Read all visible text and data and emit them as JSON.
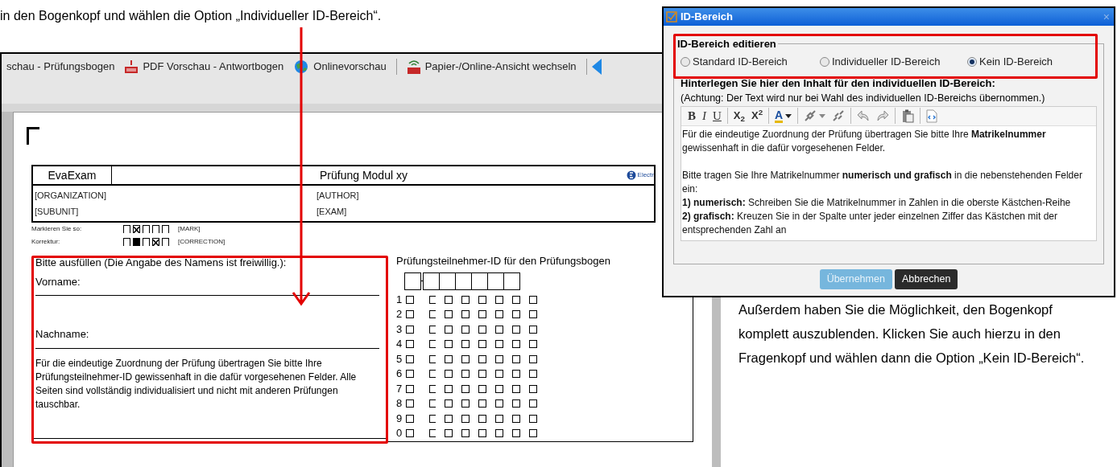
{
  "intro": "in den Bogenkopf und wählen die Option „Individueller ID-Bereich“.",
  "toolbar": {
    "items": [
      {
        "label": "schau - Prüfungsbogen",
        "kind": "plain"
      },
      {
        "label": "PDF Vorschau - Antwortbogen",
        "kind": "pdf"
      },
      {
        "label": "Onlinevorschau",
        "kind": "globe"
      },
      {
        "label": "Papier-/Online-Ansicht wechseln",
        "kind": "switch"
      }
    ]
  },
  "sheet": {
    "header": {
      "brand": "EvaExam",
      "title": "Prüfung Modul xy",
      "logo": "Electr",
      "fields": [
        [
          "[ORGANIZATION]",
          "[AUTHOR]"
        ],
        [
          "[SUBUNIT]",
          "[EXAM]"
        ]
      ]
    },
    "marking": [
      {
        "label": "Markieren Sie so:",
        "boxes": [
          {
            "kind": "box",
            "checked": false
          },
          {
            "kind": "box",
            "checked": true
          },
          {
            "kind": "box",
            "checked": false
          },
          {
            "kind": "box",
            "checked": false
          },
          {
            "kind": "box",
            "checked": false
          }
        ],
        "tag": "[MARK]"
      },
      {
        "label": "Korrektur:",
        "boxes": [
          {
            "kind": "box",
            "checked": false
          },
          {
            "kind": "blacked",
            "checked": false
          },
          {
            "kind": "box",
            "checked": false
          },
          {
            "kind": "box",
            "checked": true
          },
          {
            "kind": "box",
            "checked": false
          }
        ],
        "tag": "[CORRECTION]"
      }
    ],
    "name_form": {
      "heading": "Bitte ausfüllen (Die Angabe des Namens ist freiwillig.):",
      "fields": [
        "Vorname:",
        "Nachname:"
      ],
      "notice": "Für die eindeutige Zuordnung der Prüfung übertragen Sie bitte Ihre Prüfungsteilnehmer-ID gewissenhaft in die dafür vorgesehenen Felder. Alle Seiten sind vollständig individualisiert und nicht mit anderen Prüfungen tauschbar."
    },
    "id_grid": {
      "heading": "Prüfungsteilnehmer-ID für den Prüfungsbogen",
      "rows": [
        {
          "digit": "1",
          "checked": [
            false,
            false,
            false,
            false,
            false,
            false,
            false
          ]
        },
        {
          "digit": "2",
          "checked": [
            false,
            false,
            false,
            false,
            false,
            false,
            false
          ]
        },
        {
          "digit": "3",
          "checked": [
            false,
            false,
            false,
            false,
            false,
            false,
            false
          ]
        },
        {
          "digit": "4",
          "checked": [
            false,
            false,
            false,
            false,
            false,
            false,
            false
          ]
        },
        {
          "digit": "5",
          "checked": [
            false,
            false,
            false,
            false,
            false,
            false,
            false
          ]
        },
        {
          "digit": "6",
          "checked": [
            false,
            false,
            false,
            false,
            false,
            false,
            false
          ]
        },
        {
          "digit": "7",
          "checked": [
            false,
            false,
            false,
            false,
            false,
            false,
            false
          ]
        },
        {
          "digit": "8",
          "checked": [
            false,
            false,
            false,
            false,
            false,
            false,
            false
          ]
        },
        {
          "digit": "9",
          "checked": [
            false,
            false,
            false,
            false,
            false,
            false,
            false
          ]
        },
        {
          "digit": "0",
          "checked": [
            false,
            false,
            false,
            false,
            false,
            false,
            false
          ]
        }
      ]
    }
  },
  "dialog": {
    "title": "ID-Bereich",
    "close": "×",
    "legend": "ID-Bereich editieren",
    "options": [
      {
        "label": "Standard ID-Bereich",
        "selected": false
      },
      {
        "label": "Individueller ID-Bereich",
        "selected": false
      },
      {
        "label": "Kein ID-Bereich",
        "selected": true
      }
    ],
    "heading": "Hinterlegen Sie hier den Inhalt für den individuellen ID-Bereich:",
    "note": "(Achtung: Der Text wird nur bei Wahl des individuellen ID-Bereichs übernommen.)",
    "tools": [
      {
        "kind": "bold",
        "label": "B"
      },
      {
        "kind": "italic",
        "label": "I"
      },
      {
        "kind": "underline",
        "label": "U"
      },
      {
        "kind": "sep"
      },
      {
        "kind": "script",
        "label": "X$_{2}$"
      },
      {
        "kind": "script",
        "label": "X$^{2}$"
      },
      {
        "kind": "sep"
      },
      {
        "kind": "color",
        "label": "A"
      },
      {
        "kind": "sep"
      },
      {
        "kind": "link"
      },
      {
        "kind": "unlink"
      },
      {
        "kind": "sep"
      },
      {
        "kind": "undo"
      },
      {
        "kind": "redo"
      },
      {
        "kind": "sep"
      },
      {
        "kind": "paste"
      },
      {
        "kind": "sep"
      },
      {
        "kind": "source"
      }
    ],
    "content": [
      "Für die eindeutige Zuordnung der Prüfung übertragen Sie bitte Ihre **Matrikelnummer** gewissenhaft in die dafür vorgesehenen Felder.",
      "Bitte tragen Sie Ihre Matrikelnummer **numerisch und grafisch** in die nebenstehenden Felder ein:",
      "**1) numerisch:** Schreiben Sie die Matrikelnummer in Zahlen in die oberste Kästchen-Reihe",
      "**2) grafisch:** Kreuzen Sie in der Spalte unter jeder einzelnen Ziffer das Kästchen mit der entsprechenden Zahl an"
    ],
    "buttons": [
      {
        "label": "Übernehmen",
        "disabled": true
      },
      {
        "label": "Abbrechen",
        "disabled": false
      }
    ]
  },
  "outro": "Außerdem haben Sie die Möglichkeit, den Bogenkopf komplett auszublenden. Klicken Sie auch hierzu in den Fragenkopf und wählen dann die Option „Kein ID-Bereich“."
}
